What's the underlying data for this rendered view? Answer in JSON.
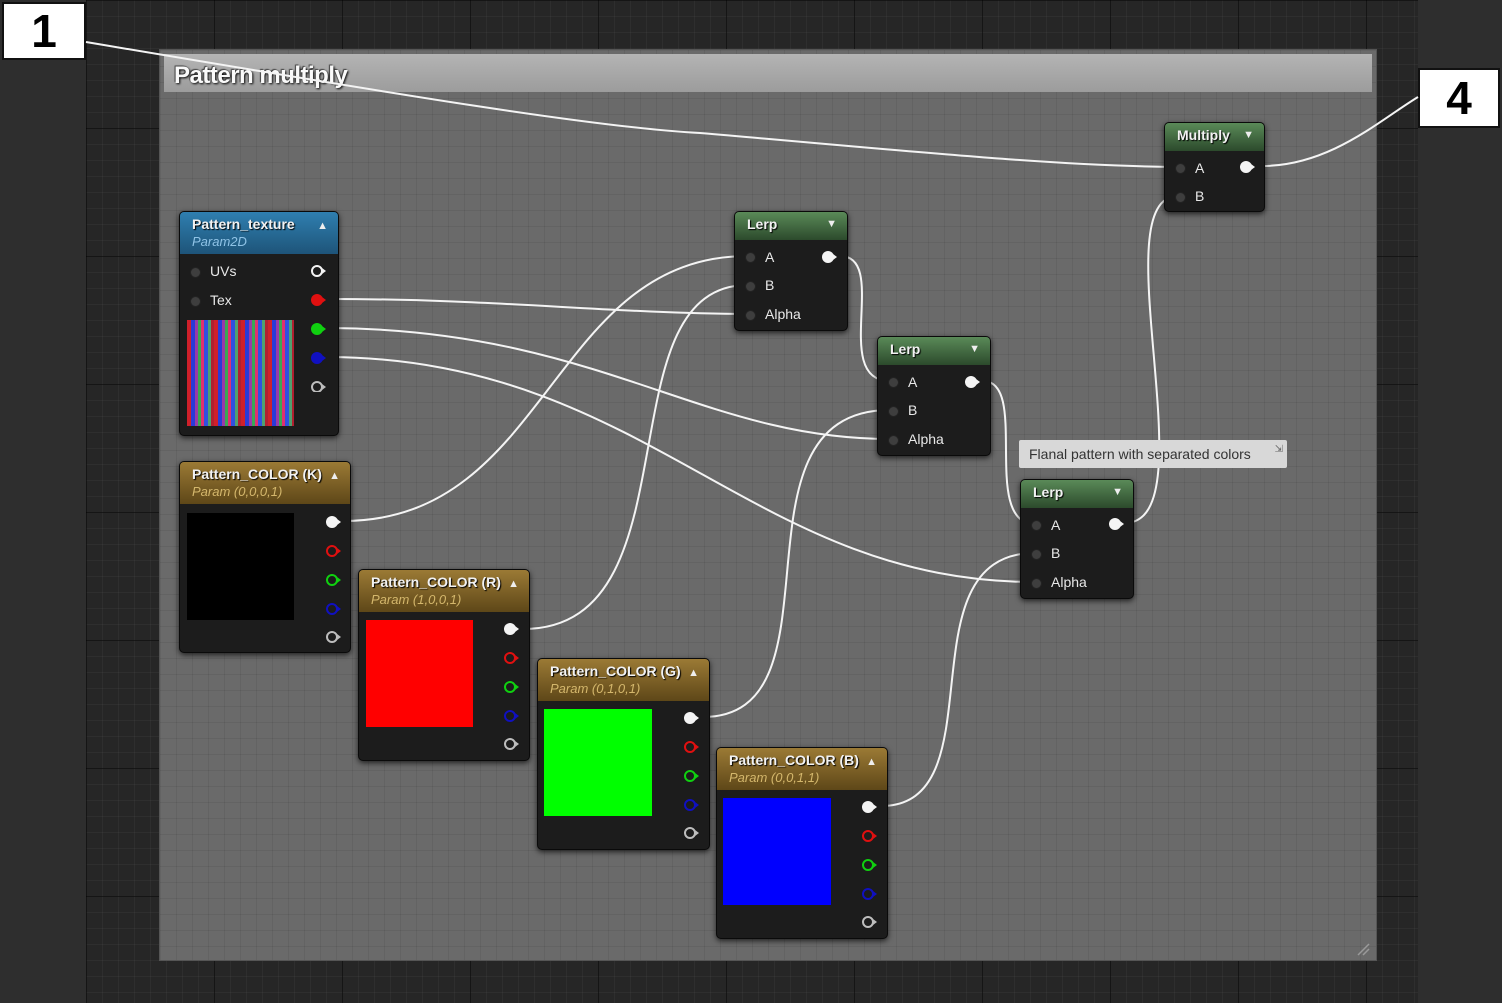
{
  "comment": {
    "title": "Pattern multiply"
  },
  "callouts": [
    {
      "label": "1"
    },
    {
      "label": "4"
    }
  ],
  "tooltip": {
    "text": "Flanal pattern with separated colors"
  },
  "nodes": {
    "texture": {
      "title": "Pattern_texture",
      "subtitle": "Param2D",
      "inputs": [
        "UVs",
        "Tex"
      ]
    },
    "color_k": {
      "title": "Pattern_COLOR (K)",
      "subtitle": "Param (0,0,0,1)",
      "swatch": "#000000"
    },
    "color_r": {
      "title": "Pattern_COLOR (R)",
      "subtitle": "Param (1,0,0,1)",
      "swatch": "#ff0000"
    },
    "color_g": {
      "title": "Pattern_COLOR (G)",
      "subtitle": "Param (0,1,0,1)",
      "swatch": "#00ff00"
    },
    "color_b": {
      "title": "Pattern_COLOR (B)",
      "subtitle": "Param (0,0,1,1)",
      "swatch": "#0000ff"
    },
    "lerp1": {
      "title": "Lerp",
      "inputs": [
        "A",
        "B",
        "Alpha"
      ]
    },
    "lerp2": {
      "title": "Lerp",
      "inputs": [
        "A",
        "B",
        "Alpha"
      ]
    },
    "lerp3": {
      "title": "Lerp",
      "inputs": [
        "A",
        "B",
        "Alpha"
      ]
    },
    "multiply": {
      "title": "Multiply",
      "inputs": [
        "A",
        "B"
      ]
    }
  },
  "pin_colors": {
    "white": "#ffffff",
    "red": "#e01010",
    "green": "#10d010",
    "blue": "#1010c0",
    "grey": "#bdbdbd"
  },
  "icons": [
    "collapse-up-icon",
    "collapse-down-icon",
    "pin-icon",
    "resize-grip-icon"
  ]
}
